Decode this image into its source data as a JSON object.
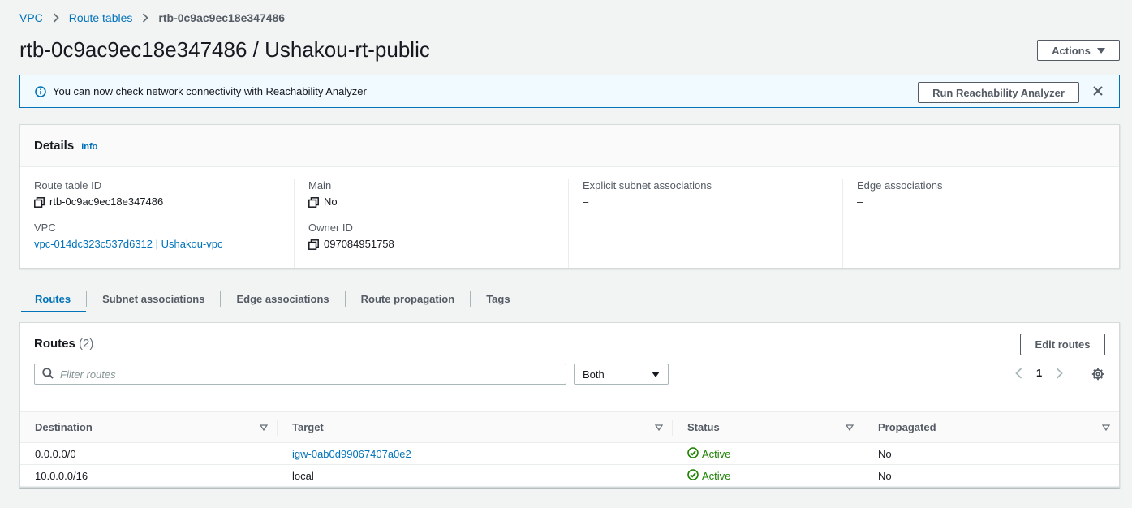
{
  "breadcrumb": {
    "items": [
      "VPC",
      "Route tables"
    ],
    "current": "rtb-0c9ac9ec18e347486"
  },
  "page": {
    "title": "rtb-0c9ac9ec18e347486 / Ushakou-rt-public",
    "actions_label": "Actions"
  },
  "flash": {
    "message": "You can now check network connectivity with Reachability Analyzer",
    "button_label": "Run Reachability Analyzer"
  },
  "details": {
    "title": "Details",
    "info_label": "Info",
    "route_table_id_label": "Route table ID",
    "route_table_id": "rtb-0c9ac9ec18e347486",
    "vpc_label": "VPC",
    "vpc_value": "vpc-014dc323c537d6312 | Ushakou-vpc",
    "main_label": "Main",
    "main_value": "No",
    "owner_label": "Owner ID",
    "owner_value": "097084951758",
    "explicit_label": "Explicit subnet associations",
    "explicit_value": "–",
    "edge_label": "Edge associations",
    "edge_value": "–"
  },
  "tabs": [
    "Routes",
    "Subnet associations",
    "Edge associations",
    "Route propagation",
    "Tags"
  ],
  "routes": {
    "title": "Routes",
    "count": "(2)",
    "edit_label": "Edit routes",
    "filter_placeholder": "Filter routes",
    "select_value": "Both",
    "page": "1",
    "columns": [
      "Destination",
      "Target",
      "Status",
      "Propagated"
    ],
    "rows": [
      {
        "destination": "0.0.0.0/0",
        "target": "igw-0ab0d99067407a0e2",
        "status": "Active",
        "propagated": "No"
      },
      {
        "destination": "10.0.0.0/16",
        "target": "local",
        "status": "Active",
        "propagated": "No"
      }
    ]
  },
  "colors": {
    "link": "#0073bb",
    "success": "#1d8102",
    "border": "#d5dbdb",
    "background": "#f2f3f3"
  }
}
